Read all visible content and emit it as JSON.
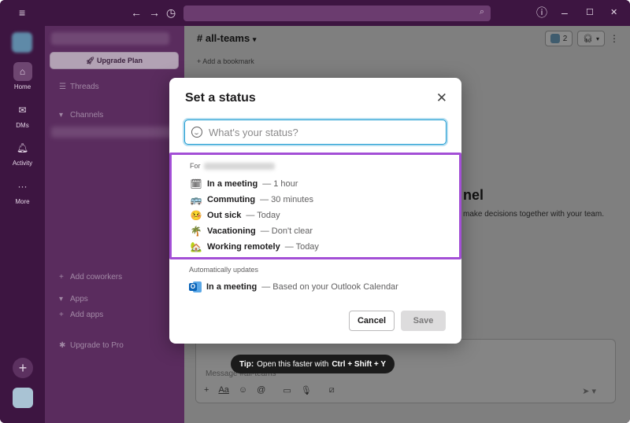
{
  "titlebar": {
    "menu_icon": "hamburger-icon",
    "back_icon": "arrow-left-icon",
    "forward_icon": "arrow-right-icon",
    "history_icon": "clock-icon",
    "help_icon": "help-icon",
    "minimize": "–",
    "maximize": "☐",
    "close": "✕"
  },
  "rail": {
    "items": [
      {
        "label": "Home",
        "icon": "home-icon"
      },
      {
        "label": "DMs",
        "icon": "dms-icon"
      },
      {
        "label": "Activity",
        "icon": "bell-icon"
      },
      {
        "label": "More",
        "icon": "more-icon"
      }
    ]
  },
  "sidebar": {
    "upgrade_plan": "Upgrade Plan",
    "threads": "Threads",
    "channels": "Channels",
    "add_coworkers": "Add coworkers",
    "apps": "Apps",
    "add_apps": "Add apps",
    "upgrade_pro": "Upgrade to Pro"
  },
  "main": {
    "channel_name": "# all-teams",
    "member_count": "2",
    "add_bookmark": "+ Add a bookmark",
    "heading_fragment": "nel",
    "sub_fragment": "make decisions together with your team.",
    "composer_placeholder": "Message #all-teams"
  },
  "modal": {
    "title": "Set a status",
    "input_placeholder": "What's your status?",
    "for_label": "For",
    "presets": [
      {
        "emoji": "🗓",
        "name": "In a meeting",
        "duration": "— 1 hour"
      },
      {
        "emoji": "🚌",
        "name": "Commuting",
        "duration": "— 30 minutes"
      },
      {
        "emoji": "🤒",
        "name": "Out sick",
        "duration": "— Today"
      },
      {
        "emoji": "🌴",
        "name": "Vacationing",
        "duration": "— Don't clear"
      },
      {
        "emoji": "🏡",
        "name": "Working remotely",
        "duration": "— Today"
      }
    ],
    "auto_title": "Automatically updates",
    "auto_item": {
      "name": "In a meeting",
      "detail": "— Based on your Outlook Calendar",
      "icon_letter": "O"
    },
    "cancel": "Cancel",
    "save": "Save"
  },
  "tip": {
    "prefix": "Tip:",
    "text": "Open this faster with",
    "shortcut": "Ctrl + Shift + Y"
  },
  "colors": {
    "highlight": "#a34fd6",
    "input_focus": "#1d9bd1",
    "frame": "#4a1d4e"
  }
}
